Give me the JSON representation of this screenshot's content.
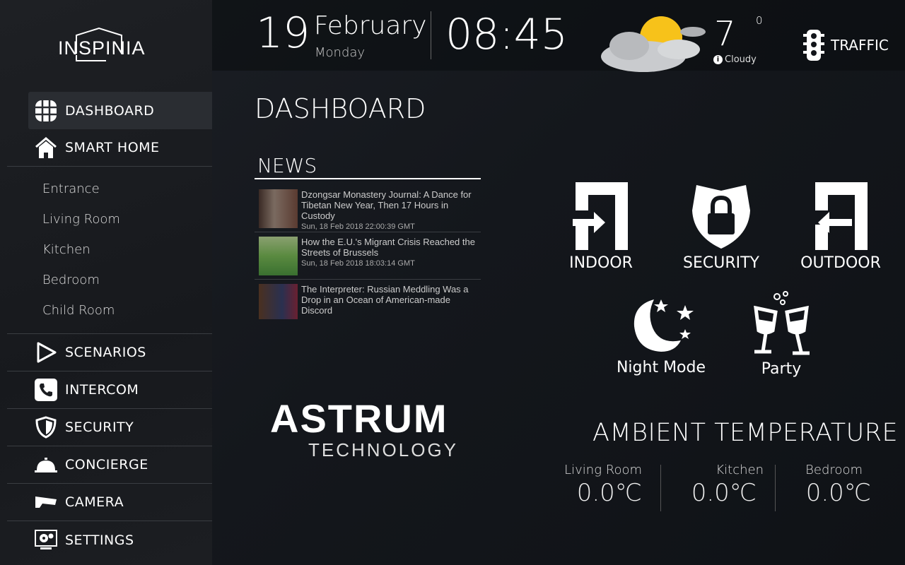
{
  "logo": "INSPINIA",
  "nav": [
    {
      "label": "DASHBOARD",
      "icon": "grid-icon",
      "active": true
    },
    {
      "label": "SMART HOME",
      "icon": "house-icon"
    },
    {
      "label": "SCENARIOS",
      "icon": "play-icon"
    },
    {
      "label": "INTERCOM",
      "icon": "phone-icon"
    },
    {
      "label": "SECURITY",
      "icon": "shield-icon"
    },
    {
      "label": "CONCIERGE",
      "icon": "service-bell-icon"
    },
    {
      "label": "CAMERA",
      "icon": "camera-icon"
    },
    {
      "label": "SETTINGS",
      "icon": "settings-icon"
    }
  ],
  "rooms_menu": [
    "Entrance",
    "Living Room",
    "Kitchen",
    "Bedroom",
    "Child Room"
  ],
  "header": {
    "day": "19",
    "month": "February",
    "weekday": "Monday",
    "time": "08:45",
    "weather": {
      "temp": "7",
      "unit": "0",
      "condition": "Cloudy",
      "icon": "partly-cloudy-icon"
    },
    "traffic": "TRAFFIC"
  },
  "page_title": "DASHBOARD",
  "news": {
    "title": "NEWS",
    "items": [
      {
        "title": "Dzongsar Monastery Journal: A Dance for Tibetan New Year, Then 17 Hours in Custody",
        "date": "Sun, 18 Feb 2018 22:00:39 GMT"
      },
      {
        "title": "How the E.U.'s Migrant Crisis Reached the Streets of Brussels",
        "date": "Sun, 18 Feb 2018 18:03:14 GMT"
      },
      {
        "title": "The Interpreter: Russian Meddling Was a Drop in an Ocean of American-made Discord",
        "date": ""
      }
    ]
  },
  "brand": {
    "name": "ASTRUM",
    "sub": "TECHNOLOGY"
  },
  "controls": [
    {
      "label": "INDOOR",
      "icon": "door-enter-icon"
    },
    {
      "label": "SECURITY",
      "icon": "shield-lock-icon"
    },
    {
      "label": "OUTDOOR",
      "icon": "door-exit-icon"
    },
    {
      "label": "Night Mode",
      "icon": "moon-stars-icon"
    },
    {
      "label": "Party",
      "icon": "champagne-glasses-icon"
    }
  ],
  "ambient": {
    "title": "AMBIENT TEMPERATURE",
    "rooms": [
      {
        "name": "Living Room",
        "value": "0.0℃"
      },
      {
        "name": "Kitchen",
        "value": "0.0℃"
      },
      {
        "name": "Bedroom",
        "value": "0.0℃"
      }
    ]
  }
}
